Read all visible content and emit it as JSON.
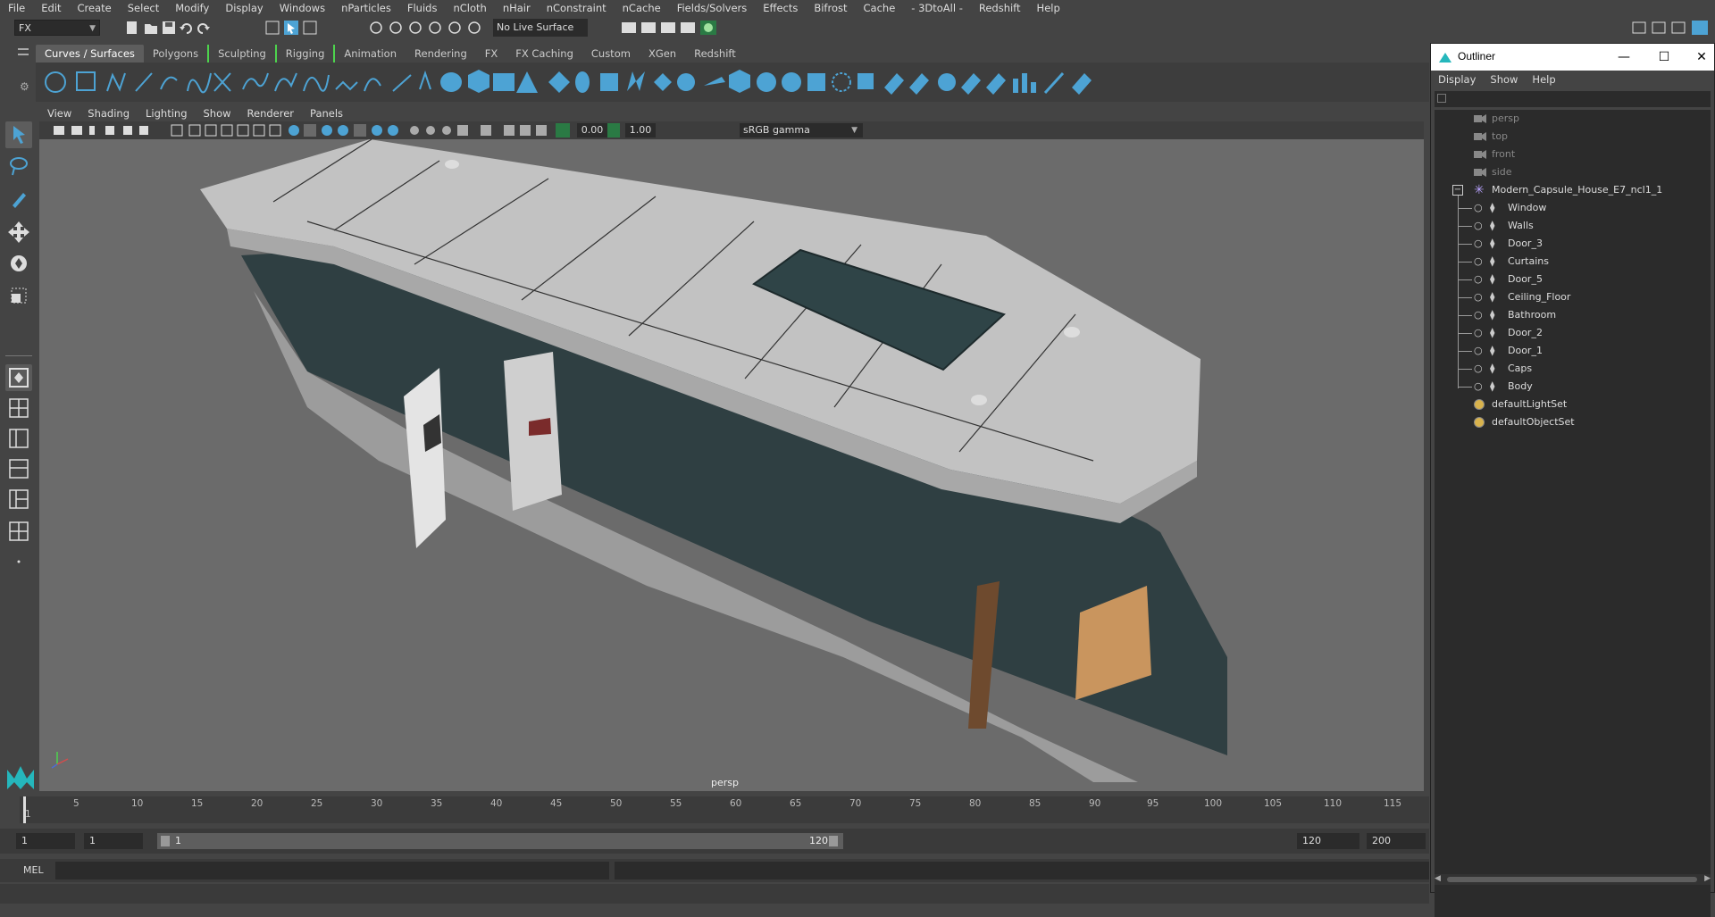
{
  "menubar": {
    "items": [
      "File",
      "Edit",
      "Create",
      "Select",
      "Modify",
      "Display",
      "Windows",
      "nParticles",
      "Fluids",
      "nCloth",
      "nHair",
      "nConstraint",
      "nCache",
      "Fields/Solvers",
      "Effects",
      "Bifrost",
      "Cache",
      "- 3DtoAll -",
      "Redshift",
      "Help"
    ]
  },
  "statusline": {
    "mode": "FX",
    "live_surface": "No Live Surface"
  },
  "shelf": {
    "tabs": [
      "Curves / Surfaces",
      "Polygons",
      "Sculpting",
      "Rigging",
      "Animation",
      "Rendering",
      "FX",
      "FX Caching",
      "Custom",
      "XGen",
      "Redshift"
    ],
    "active_tab": "Curves / Surfaces"
  },
  "viewport": {
    "menu": [
      "View",
      "Shading",
      "Lighting",
      "Show",
      "Renderer",
      "Panels"
    ],
    "exposure": "0.00",
    "gamma_value": "1.00",
    "color_space": "sRGB gamma",
    "camera_label": "persp"
  },
  "timeline": {
    "ticks": [
      "5",
      "10",
      "15",
      "20",
      "25",
      "30",
      "35",
      "40",
      "45",
      "50",
      "55",
      "60",
      "65",
      "70",
      "75",
      "80",
      "85",
      "90",
      "95",
      "100",
      "105",
      "110",
      "115"
    ],
    "current_frame": "1",
    "range_start": "1",
    "range_playback_start": "1",
    "range_bar_start": "1",
    "range_bar_end": "120",
    "range_end": "120",
    "anim_end": "200"
  },
  "commandline": {
    "label": "MEL"
  },
  "outliner": {
    "title": "Outliner",
    "menu": [
      "Display",
      "Show",
      "Help"
    ],
    "cameras": [
      "persp",
      "top",
      "front",
      "side"
    ],
    "group": "Modern_Capsule_House_E7_ncl1_1",
    "children": [
      "Window",
      "Walls",
      "Door_3",
      "Curtains",
      "Door_5",
      "Ceiling_Floor",
      "Bathroom",
      "Door_2",
      "Door_1",
      "Caps",
      "Body"
    ],
    "sets": [
      "defaultLightSet",
      "defaultObjectSet"
    ]
  },
  "colors": {
    "accent": "#4da3d4",
    "ui_bg": "#444444",
    "viewport_bg": "#6b6b6b",
    "capsule_body": "#bdbdbd",
    "capsule_glass": "#2f3f42",
    "wood": "#c9955e"
  }
}
